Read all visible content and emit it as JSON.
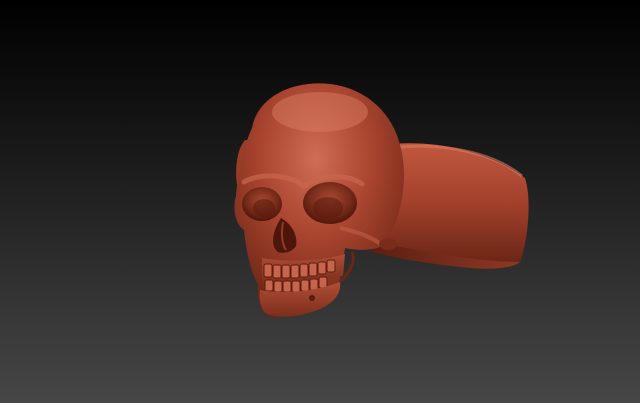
{
  "viewport": {
    "background_top": "#000000",
    "background_bottom": "#474747"
  },
  "model": {
    "subject": "skull-ring",
    "material_color": "#a8452f",
    "highlight_color": "#d06e55",
    "shadow_color": "#4a160c"
  }
}
